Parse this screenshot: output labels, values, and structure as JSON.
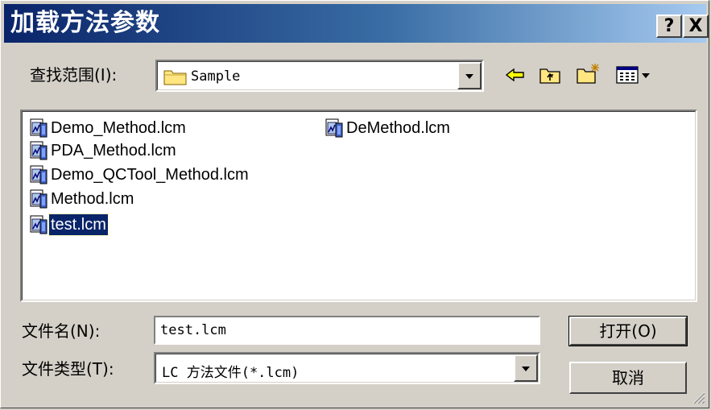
{
  "dialog": {
    "title": "加载方法参数",
    "help_label": "?",
    "close_label": "X"
  },
  "lookin": {
    "label": "查找范围",
    "accel": "(I):",
    "value": "Sample"
  },
  "toolbar": {
    "icons": [
      "back-arrow-icon",
      "up-folder-icon",
      "new-folder-icon",
      "view-menu-icon"
    ]
  },
  "files": [
    {
      "name": "Demo_Method.lcm",
      "selected": false
    },
    {
      "name": "DeMethod.lcm",
      "selected": false
    },
    {
      "name": "PDA_Method.lcm",
      "selected": false
    },
    {
      "name": "Demo_QCTool_Method.lcm",
      "selected": false
    },
    {
      "name": "Method.lcm",
      "selected": false
    },
    {
      "name": "test.lcm",
      "selected": true
    }
  ],
  "filename": {
    "label": "文件名",
    "accel": "(N):",
    "value": "test.lcm"
  },
  "filetype": {
    "label": "文件类型",
    "accel": "(T):",
    "value": "LC 方法文件(*.lcm)"
  },
  "buttons": {
    "open": "打开(O)",
    "cancel": "取消"
  },
  "colors": {
    "title_start": "#0a246a",
    "title_end": "#a6caf0",
    "face": "#d4d0c8",
    "selection": "#0a246a"
  }
}
